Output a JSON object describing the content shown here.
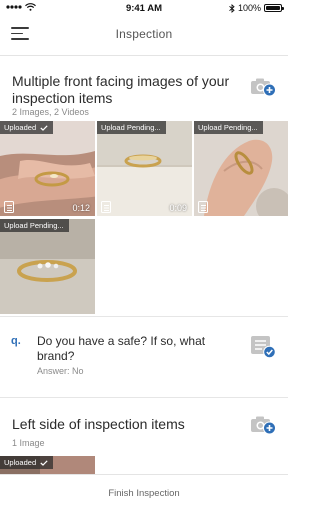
{
  "status_bar": {
    "time": "9:41 AM",
    "battery_text": "100%"
  },
  "nav": {
    "title": "Inspection"
  },
  "section1": {
    "title": "Multiple front facing images of your inspection items",
    "subtitle": "2 Images, 2 Videos",
    "tiles": [
      {
        "badge": "Uploaded",
        "duration": "0:12",
        "type": "video"
      },
      {
        "badge": "Upload Pending...",
        "duration": "0:09",
        "type": "video"
      },
      {
        "badge": "Upload Pending...",
        "duration": "",
        "type": "image"
      },
      {
        "badge": "Upload Pending...",
        "duration": "",
        "type": "image"
      }
    ]
  },
  "question": {
    "letter": "q.",
    "text": "Do you have a safe? If so, what brand?",
    "answer": "Answer: No"
  },
  "section2": {
    "title": "Left side of inspection items",
    "subtitle": "1 Image",
    "tiles": [
      {
        "badge": "Uploaded"
      }
    ]
  },
  "bottom": {
    "finish_label": "Finish Inspection"
  },
  "colors": {
    "accent": "#2f6fb7",
    "icon_gray": "#c4c4c4"
  }
}
